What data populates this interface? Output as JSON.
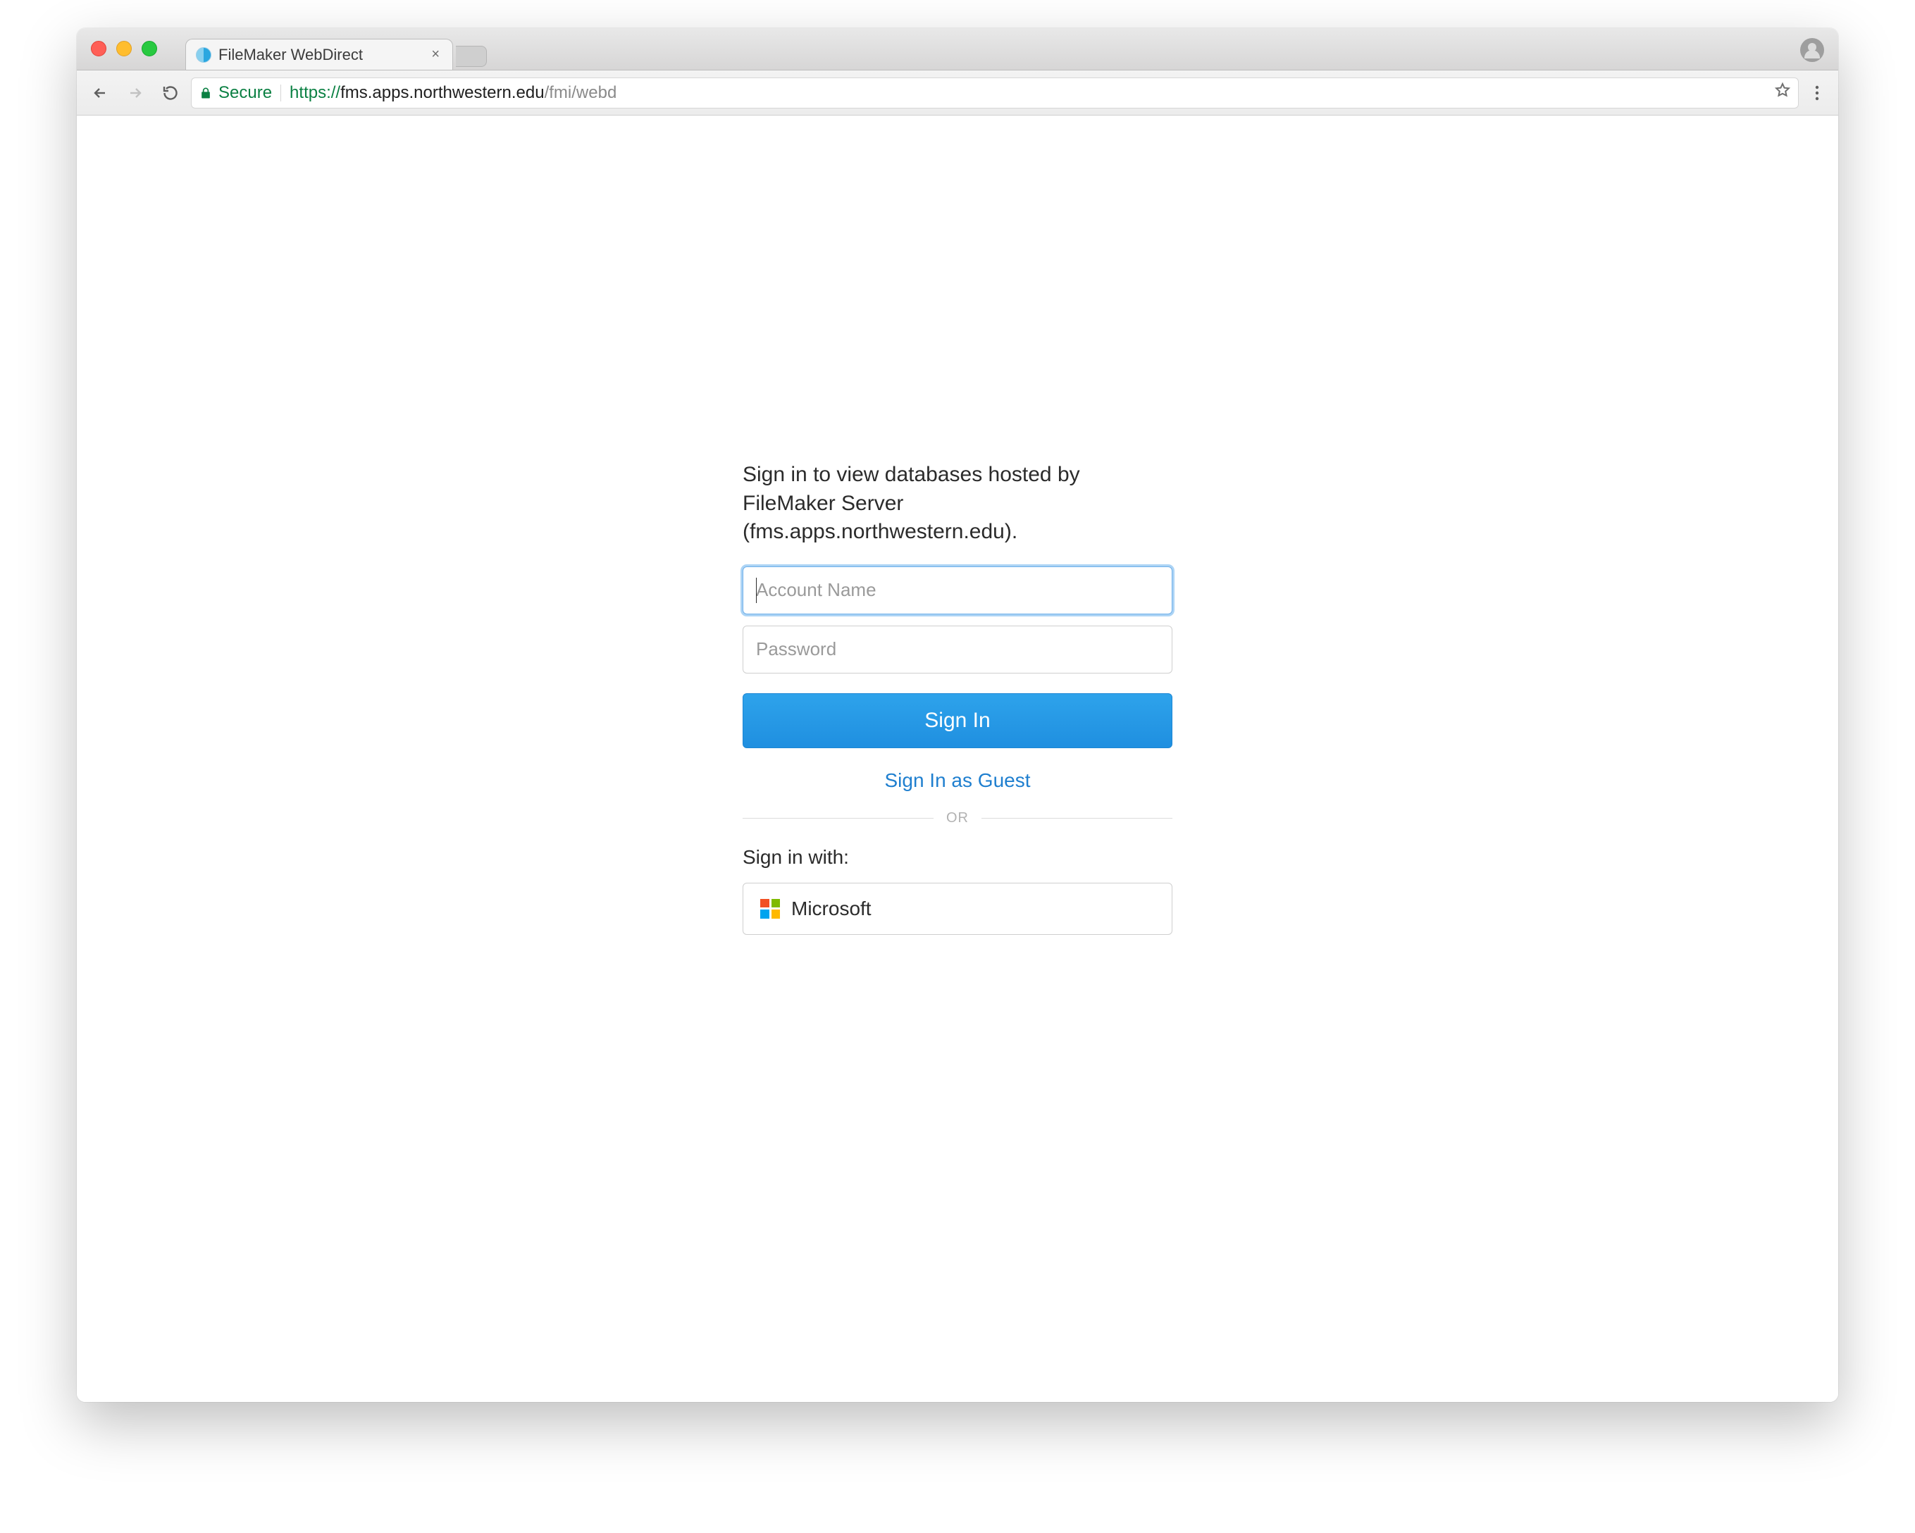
{
  "browser": {
    "tab_title": "FileMaker WebDirect",
    "secure_label": "Secure",
    "url_proto": "https://",
    "url_host": "fms.apps.northwestern.edu",
    "url_path": "/fmi/webd"
  },
  "login": {
    "prompt": "Sign in to view databases hosted by FileMaker Server (fms.apps.northwestern.edu).",
    "account_placeholder": "Account Name",
    "account_value": "",
    "password_placeholder": "Password",
    "password_value": "",
    "sign_in_label": "Sign In",
    "guest_label": "Sign In as Guest",
    "divider_label": "OR",
    "sign_in_with_label": "Sign in with:",
    "oauth": {
      "microsoft_label": "Microsoft"
    }
  }
}
